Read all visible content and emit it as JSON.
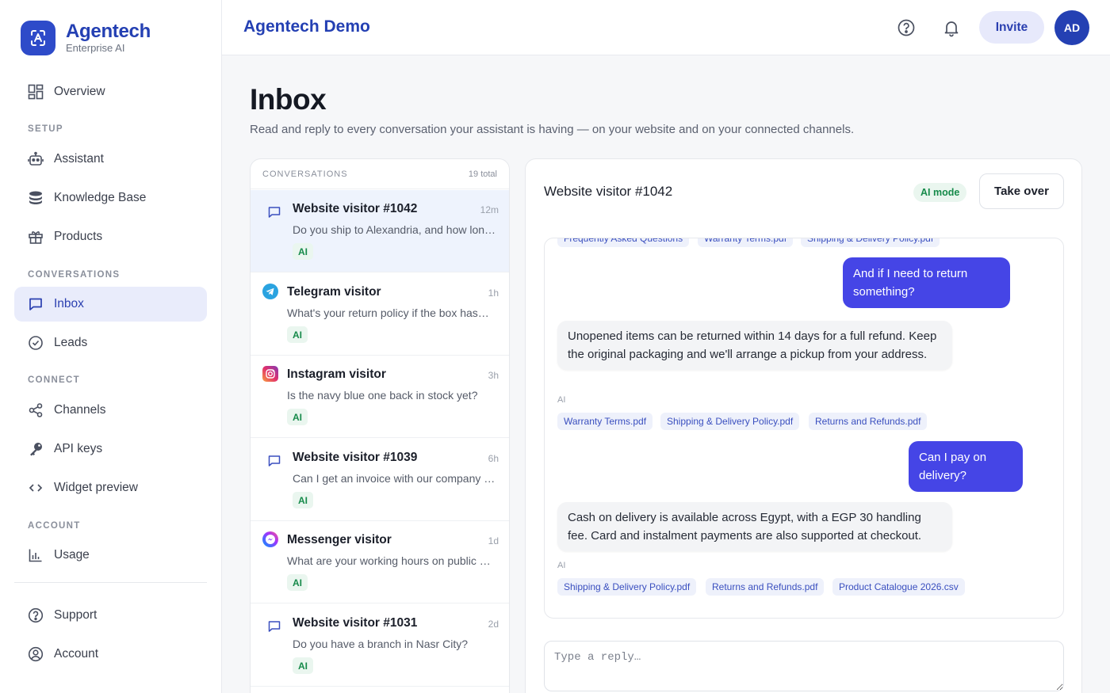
{
  "brand": {
    "name": "Agentech",
    "subtitle": "Enterprise AI"
  },
  "sidebar": {
    "overview": "Overview",
    "sections": {
      "setup": "SETUP",
      "conversations": "CONVERSATIONS",
      "connect": "CONNECT",
      "account": "ACCOUNT"
    },
    "items": {
      "assistant": "Assistant",
      "knowledge_base": "Knowledge Base",
      "products": "Products",
      "inbox": "Inbox",
      "leads": "Leads",
      "channels": "Channels",
      "api_keys": "API keys",
      "widget_preview": "Widget preview",
      "usage": "Usage",
      "support": "Support",
      "account": "Account"
    },
    "active": "inbox"
  },
  "header": {
    "title": "Agentech Demo",
    "invite_label": "Invite",
    "avatar_initials": "AD"
  },
  "page": {
    "title": "Inbox",
    "subtitle": "Read and reply to every conversation your assistant is having — on your website and on your connected channels."
  },
  "conversations": {
    "label": "CONVERSATIONS",
    "total": "19 total",
    "items": [
      {
        "name": "Website visitor #1042",
        "time": "12m",
        "preview": "Do you ship to Alexandria, and how long does it take?",
        "badge": "AI",
        "channel": "website-chat-icon"
      },
      {
        "name": "Telegram visitor",
        "time": "1h",
        "preview": "What's your return policy if the box has been opened?",
        "badge": "AI",
        "channel": "telegram-icon"
      },
      {
        "name": "Instagram visitor",
        "time": "3h",
        "preview": "Is the navy blue one back in stock yet?",
        "badge": "AI",
        "channel": "instagram-icon"
      },
      {
        "name": "Website visitor #1039",
        "time": "6h",
        "preview": "Can I get an invoice with our company name on it?",
        "badge": "AI",
        "channel": "website-chat-icon"
      },
      {
        "name": "Messenger visitor",
        "time": "1d",
        "preview": "What are your working hours on public holidays?",
        "badge": "AI",
        "channel": "messenger-icon"
      },
      {
        "name": "Website visitor #1031",
        "time": "2d",
        "preview": "Do you have a branch in Nasr City?",
        "badge": "AI",
        "channel": "website-chat-icon"
      }
    ]
  },
  "chat": {
    "title": "Website visitor #1042",
    "mode": "AI mode",
    "takeover_label": "Take over",
    "top_chips": [
      "Frequently Asked Questions",
      "Warranty Terms.pdf",
      "Shipping & Delivery Policy.pdf"
    ],
    "messages": [
      {
        "role": "user",
        "text": "And if I need to return something?"
      },
      {
        "role": "assistant",
        "text": "Unopened items can be returned within 14 days for a full refund. Keep the original packaging and we'll arrange a pickup from your address.",
        "label": "AI",
        "sources": [
          "Warranty Terms.pdf",
          "Shipping & Delivery Policy.pdf",
          "Returns and Refunds.pdf"
        ]
      },
      {
        "role": "user",
        "text": "Can I pay on delivery?"
      },
      {
        "role": "assistant",
        "text": "Cash on delivery is available across Egypt, with a EGP 30 handling fee. Card and instalment payments are also supported at checkout.",
        "label": "AI",
        "sources": [
          "Shipping & Delivery Policy.pdf",
          "Returns and Refunds.pdf",
          "Product Catalogue 2026.csv"
        ]
      }
    ],
    "reply_placeholder": "Type a reply…"
  },
  "colors": {
    "brand": "#2440b3",
    "user_bubble": "#4545e6",
    "ai_badge": "#168a4a",
    "active_nav": "#e9ecfb"
  }
}
